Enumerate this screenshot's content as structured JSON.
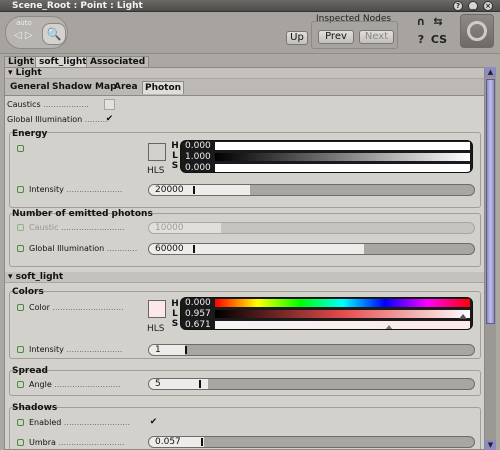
{
  "window": {
    "title": "Scene_Root : Point : Light",
    "btn_help": "?",
    "btn_min": "_",
    "btn_close": "×"
  },
  "header": {
    "nav_auto": "auto",
    "nav_arrows": "◁ ▷",
    "magnify_glyph": "🔍",
    "inspected_label": "Inspected Nodes",
    "up_label": "Up",
    "prev_label": "Prev",
    "next_label": "Next",
    "lock_glyph": "∩",
    "link_glyph": "⇆",
    "help_glyph": "?",
    "cs_glyph": "CS"
  },
  "tabs": {
    "light": "Light",
    "soft_light": "soft_light",
    "associated": "Associated Models"
  },
  "light_section": {
    "header": "▾ Light",
    "subtabs": [
      "General",
      "Shadow Map",
      "Area",
      "Photon"
    ],
    "caustics_label": "Caustics",
    "gi_label": "Global Illumination",
    "gi_checked": "✔",
    "energy": {
      "title": "Energy",
      "color": "#FFFFFF",
      "hls_letters": [
        "H",
        "L",
        "S"
      ],
      "hls_word": "HLS",
      "values": [
        "0.000",
        "1.000",
        "0.000"
      ],
      "intensity_label": "Intensity",
      "intensity_value": "20000",
      "intensity_fill": 0.31
    },
    "photons": {
      "title": "Number of emitted photons",
      "caustic_label": "Caustic",
      "caustic_value": "10000",
      "caustic_fill": 0.22,
      "gi_label": "Global Illumination",
      "gi_value": "60000",
      "gi_fill": 0.66
    }
  },
  "soft_light_section": {
    "header": "▾ soft_light",
    "colors": {
      "title": "Colors",
      "color_label": "Color",
      "color": "#FCE8E8",
      "hls_letters": [
        "H",
        "L",
        "S"
      ],
      "hls_word": "HLS",
      "values": [
        "0.000",
        "0.957",
        "0.671"
      ],
      "intensity_label": "Intensity",
      "intensity_value": "1",
      "intensity_fill": 0.11
    },
    "spread": {
      "title": "Spread",
      "angle_label": "Angle",
      "angle_value": "5",
      "angle_fill": 0.18
    },
    "shadows": {
      "title": "Shadows",
      "enabled_label": "Enabled",
      "enabled_checked": "✔",
      "umbra_label": "Umbra",
      "umbra_value": "0.057",
      "umbra_fill": 0.17
    }
  },
  "scrollbar": {
    "up": "▲",
    "down": "▼"
  }
}
